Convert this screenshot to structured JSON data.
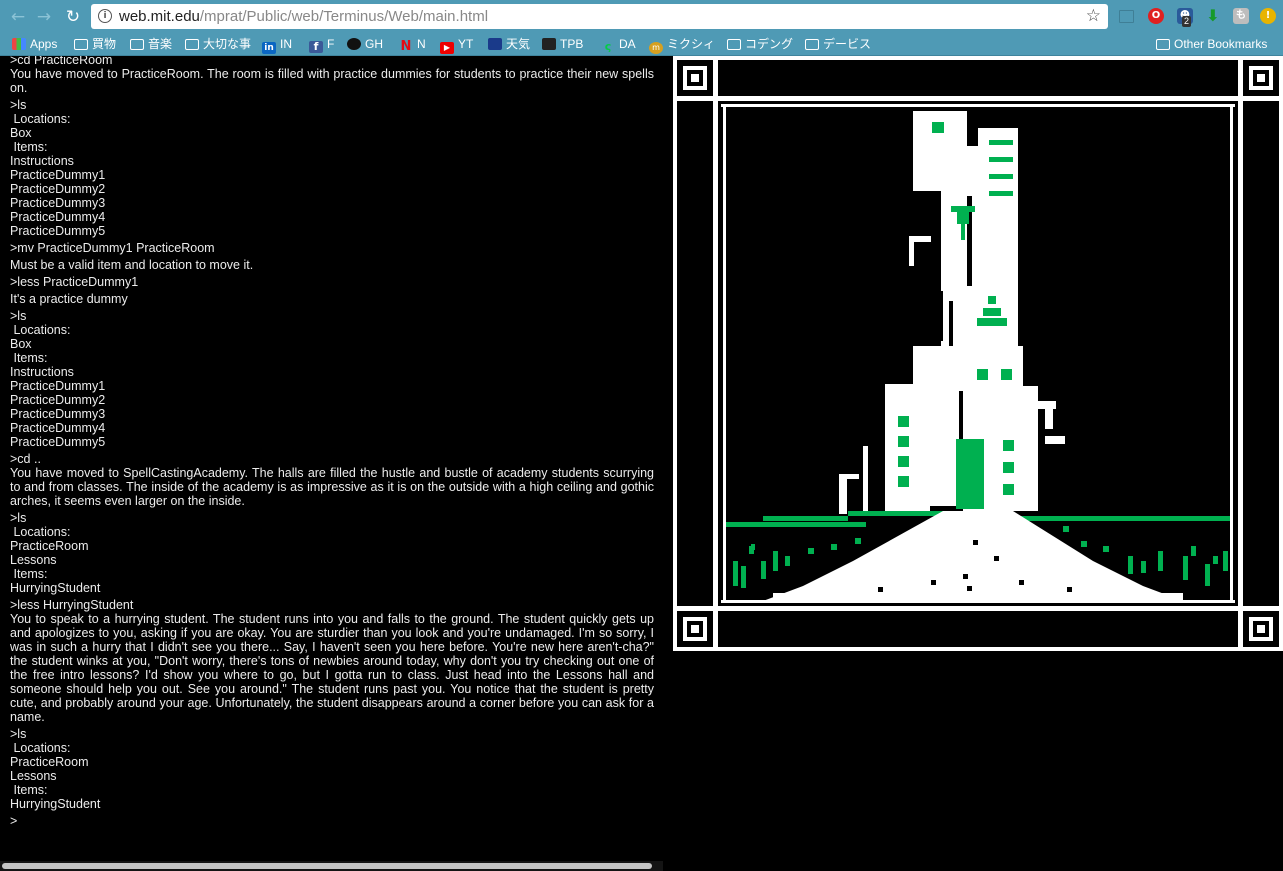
{
  "browser": {
    "url_host": "web.mit.edu",
    "url_path": "/mprat/Public/web/Terminus/Web/main.html",
    "icons": {
      "back": "arrow-left-icon",
      "forward": "arrow-right-icon",
      "reload": "reload-icon",
      "info": "info-icon",
      "star": "star-icon"
    },
    "extensions": [
      {
        "name": "cast-icon",
        "label": ""
      },
      {
        "name": "opera-icon",
        "label": "O"
      },
      {
        "name": "ghostery-icon",
        "label": "",
        "badge": "2"
      },
      {
        "name": "download-icon",
        "label": "⬇"
      },
      {
        "name": "extension-gray-icon",
        "label": "も"
      },
      {
        "name": "warning-icon",
        "label": "!"
      }
    ]
  },
  "bookmarks": {
    "items": [
      {
        "label": "Apps",
        "icon": "apps-grid-icon"
      },
      {
        "label": "買物",
        "icon": "folder-icon"
      },
      {
        "label": "音楽",
        "icon": "folder-icon"
      },
      {
        "label": "大切な事",
        "icon": "folder-icon"
      },
      {
        "label": "IN",
        "icon": "linkedin-icon"
      },
      {
        "label": "F",
        "icon": "facebook-icon"
      },
      {
        "label": "GH",
        "icon": "github-icon"
      },
      {
        "label": "N",
        "icon": "netflix-icon"
      },
      {
        "label": "YT",
        "icon": "youtube-icon"
      },
      {
        "label": "天気",
        "icon": "weather-channel-icon"
      },
      {
        "label": "TPB",
        "icon": "tpb-icon"
      },
      {
        "label": "DA",
        "icon": "deviantart-icon"
      },
      {
        "label": "ミクシィ",
        "icon": "mixi-icon"
      },
      {
        "label": "コデング",
        "icon": "folder-icon"
      },
      {
        "label": "デービス",
        "icon": "folder-icon"
      }
    ],
    "other": "Other Bookmarks"
  },
  "terminal": {
    "lines": [
      {
        "t": ">cd PracticeRoom",
        "k": "cmd"
      },
      {
        "t": "You have moved to PracticeRoom. The room is filled with practice dummies for students to practice their new spells on.",
        "k": "just"
      },
      {
        "t": ">ls",
        "k": "cmd"
      },
      {
        "t": " Locations:",
        "k": ""
      },
      {
        "t": "Box",
        "k": ""
      },
      {
        "t": " Items:",
        "k": ""
      },
      {
        "t": "Instructions",
        "k": ""
      },
      {
        "t": "PracticeDummy1",
        "k": ""
      },
      {
        "t": "PracticeDummy2",
        "k": ""
      },
      {
        "t": "PracticeDummy3",
        "k": ""
      },
      {
        "t": "PracticeDummy4",
        "k": ""
      },
      {
        "t": "PracticeDummy5",
        "k": ""
      },
      {
        "t": ">mv PracticeDummy1 PracticeRoom",
        "k": "cmd"
      },
      {
        "t": "Must be a valid item and location to move it.",
        "k": "cmd"
      },
      {
        "t": ">less PracticeDummy1",
        "k": "cmd"
      },
      {
        "t": "It's a practice dummy",
        "k": "cmd"
      },
      {
        "t": ">ls",
        "k": "cmd"
      },
      {
        "t": " Locations:",
        "k": ""
      },
      {
        "t": "Box",
        "k": ""
      },
      {
        "t": " Items:",
        "k": ""
      },
      {
        "t": "Instructions",
        "k": ""
      },
      {
        "t": "PracticeDummy1",
        "k": ""
      },
      {
        "t": "PracticeDummy2",
        "k": ""
      },
      {
        "t": "PracticeDummy3",
        "k": ""
      },
      {
        "t": "PracticeDummy4",
        "k": ""
      },
      {
        "t": "PracticeDummy5",
        "k": ""
      },
      {
        "t": ">cd ..",
        "k": "cmd"
      },
      {
        "t": "You have moved to SpellCastingAcademy. The halls are filled the hustle and bustle of academy students scurrying to and from classes. The inside of the academy is as impressive as it is on the outside with a high ceiling and gothic arches, it seems even larger on the inside.",
        "k": "just"
      },
      {
        "t": ">ls",
        "k": "cmd"
      },
      {
        "t": " Locations:",
        "k": ""
      },
      {
        "t": "PracticeRoom",
        "k": ""
      },
      {
        "t": "Lessons",
        "k": ""
      },
      {
        "t": " Items:",
        "k": ""
      },
      {
        "t": "HurryingStudent",
        "k": ""
      },
      {
        "t": ">less HurryingStudent",
        "k": "cmd"
      },
      {
        "t": "You to speak to a hurrying student. The student runs into you and falls to the ground. The student quickly gets up and apologizes to you, asking if you are okay. You are sturdier than you look and you're undamaged. I'm so sorry, I was in such a hurry that I didn't see you there... Say, I haven't seen you here before. You're new here aren't-cha?\" the student winks at you, \"Don't worry, there's tons of newbies around today, why don't you try checking out one of the free intro lessons? I'd show you where to go, but I gotta run to class. Just head into the Lessons hall and someone should help you out. See you around.\" The student runs past you. You notice that the student is pretty cute, and probably around your age. Unfortunately, the student disappears around a corner before you can ask for a name.",
        "k": "just"
      },
      {
        "t": ">ls",
        "k": "cmd"
      },
      {
        "t": " Locations:",
        "k": ""
      },
      {
        "t": "PracticeRoom",
        "k": ""
      },
      {
        "t": "Lessons",
        "k": ""
      },
      {
        "t": " Items:",
        "k": ""
      },
      {
        "t": "HurryingStudent",
        "k": ""
      },
      {
        "t": ">",
        "k": "cmd"
      }
    ]
  },
  "colors": {
    "chrome": "#4f9ab5",
    "terminal_bg": "#000000",
    "terminal_text": "#ececec",
    "art_green": "#00b050"
  }
}
